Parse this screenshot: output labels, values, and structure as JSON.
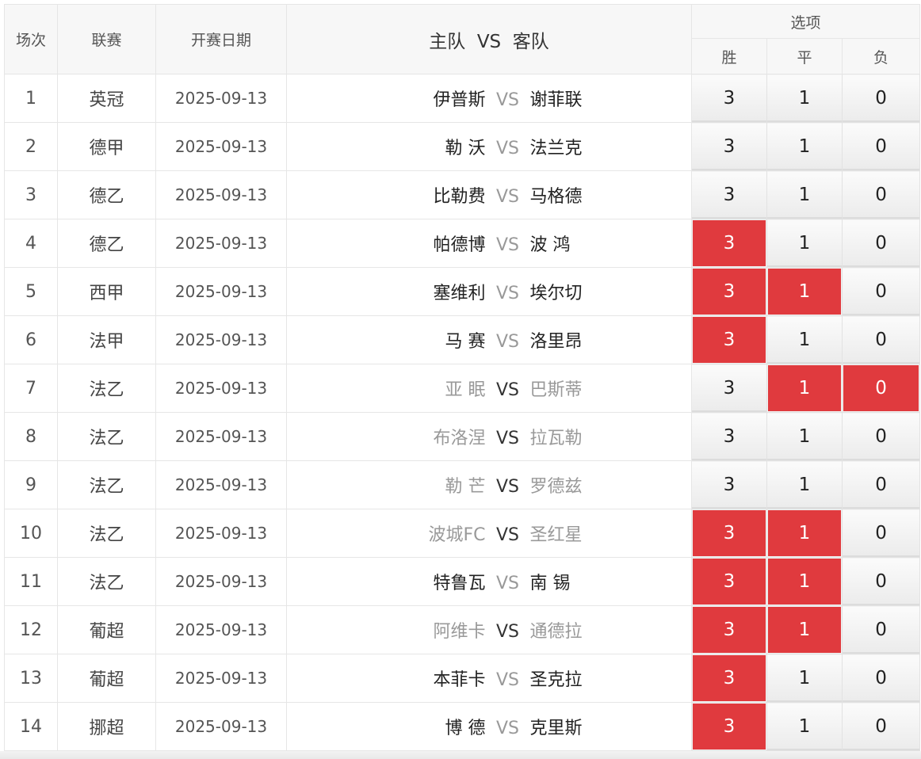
{
  "headers": {
    "num": "场次",
    "league": "联赛",
    "date": "开赛日期",
    "match_home": "主队",
    "match_vs": "VS",
    "match_away": "客队",
    "options": "选项",
    "win": "胜",
    "draw": "平",
    "lose": "负"
  },
  "rows": [
    {
      "num": "1",
      "league": "英冠",
      "date": "2025-09-13",
      "home": "伊普斯",
      "away": "谢菲联",
      "vs": "VS",
      "win": "3",
      "draw": "1",
      "lose": "0",
      "home_muted": false,
      "away_muted": false,
      "vs_dark": false,
      "win_sel": false,
      "draw_sel": false,
      "lose_sel": false
    },
    {
      "num": "2",
      "league": "德甲",
      "date": "2025-09-13",
      "home": "勒 沃",
      "away": "法兰克",
      "vs": "VS",
      "win": "3",
      "draw": "1",
      "lose": "0",
      "home_muted": false,
      "away_muted": false,
      "vs_dark": false,
      "win_sel": false,
      "draw_sel": false,
      "lose_sel": false
    },
    {
      "num": "3",
      "league": "德乙",
      "date": "2025-09-13",
      "home": "比勒费",
      "away": "马格德",
      "vs": "VS",
      "win": "3",
      "draw": "1",
      "lose": "0",
      "home_muted": false,
      "away_muted": false,
      "vs_dark": false,
      "win_sel": false,
      "draw_sel": false,
      "lose_sel": false
    },
    {
      "num": "4",
      "league": "德乙",
      "date": "2025-09-13",
      "home": "帕德博",
      "away": "波 鸿",
      "vs": "VS",
      "win": "3",
      "draw": "1",
      "lose": "0",
      "home_muted": false,
      "away_muted": false,
      "vs_dark": false,
      "win_sel": true,
      "draw_sel": false,
      "lose_sel": false
    },
    {
      "num": "5",
      "league": "西甲",
      "date": "2025-09-13",
      "home": "塞维利",
      "away": "埃尔切",
      "vs": "VS",
      "win": "3",
      "draw": "1",
      "lose": "0",
      "home_muted": false,
      "away_muted": false,
      "vs_dark": false,
      "win_sel": true,
      "draw_sel": true,
      "lose_sel": false
    },
    {
      "num": "6",
      "league": "法甲",
      "date": "2025-09-13",
      "home": "马 赛",
      "away": "洛里昂",
      "vs": "VS",
      "win": "3",
      "draw": "1",
      "lose": "0",
      "home_muted": false,
      "away_muted": false,
      "vs_dark": false,
      "win_sel": true,
      "draw_sel": false,
      "lose_sel": false
    },
    {
      "num": "7",
      "league": "法乙",
      "date": "2025-09-13",
      "home": "亚 眠",
      "away": "巴斯蒂",
      "vs": "VS",
      "win": "3",
      "draw": "1",
      "lose": "0",
      "home_muted": true,
      "away_muted": true,
      "vs_dark": true,
      "win_sel": false,
      "draw_sel": true,
      "lose_sel": true
    },
    {
      "num": "8",
      "league": "法乙",
      "date": "2025-09-13",
      "home": "布洛涅",
      "away": "拉瓦勒",
      "vs": "VS",
      "win": "3",
      "draw": "1",
      "lose": "0",
      "home_muted": true,
      "away_muted": true,
      "vs_dark": true,
      "win_sel": false,
      "draw_sel": false,
      "lose_sel": false
    },
    {
      "num": "9",
      "league": "法乙",
      "date": "2025-09-13",
      "home": "勒 芒",
      "away": "罗德兹",
      "vs": "VS",
      "win": "3",
      "draw": "1",
      "lose": "0",
      "home_muted": true,
      "away_muted": true,
      "vs_dark": true,
      "win_sel": false,
      "draw_sel": false,
      "lose_sel": false
    },
    {
      "num": "10",
      "league": "法乙",
      "date": "2025-09-13",
      "home": "波城FC",
      "away": "圣红星",
      "vs": "VS",
      "win": "3",
      "draw": "1",
      "lose": "0",
      "home_muted": true,
      "away_muted": true,
      "vs_dark": true,
      "win_sel": true,
      "draw_sel": true,
      "lose_sel": false
    },
    {
      "num": "11",
      "league": "法乙",
      "date": "2025-09-13",
      "home": "特鲁瓦",
      "away": "南 锡",
      "vs": "VS",
      "win": "3",
      "draw": "1",
      "lose": "0",
      "home_muted": false,
      "away_muted": false,
      "vs_dark": false,
      "win_sel": true,
      "draw_sel": true,
      "lose_sel": false
    },
    {
      "num": "12",
      "league": "葡超",
      "date": "2025-09-13",
      "home": "阿维卡",
      "away": "通德拉",
      "vs": "VS",
      "win": "3",
      "draw": "1",
      "lose": "0",
      "home_muted": true,
      "away_muted": true,
      "vs_dark": true,
      "win_sel": true,
      "draw_sel": true,
      "lose_sel": false
    },
    {
      "num": "13",
      "league": "葡超",
      "date": "2025-09-13",
      "home": "本菲卡",
      "away": "圣克拉",
      "vs": "VS",
      "win": "3",
      "draw": "1",
      "lose": "0",
      "home_muted": false,
      "away_muted": false,
      "vs_dark": false,
      "win_sel": true,
      "draw_sel": false,
      "lose_sel": false
    },
    {
      "num": "14",
      "league": "挪超",
      "date": "2025-09-13",
      "home": "博 德",
      "away": "克里斯",
      "vs": "VS",
      "win": "3",
      "draw": "1",
      "lose": "0",
      "home_muted": false,
      "away_muted": false,
      "vs_dark": false,
      "win_sel": true,
      "draw_sel": false,
      "lose_sel": false
    }
  ],
  "colors": {
    "selected": "#e03a3e",
    "header_bg": "#f7f7f7",
    "muted_text": "#999999"
  }
}
